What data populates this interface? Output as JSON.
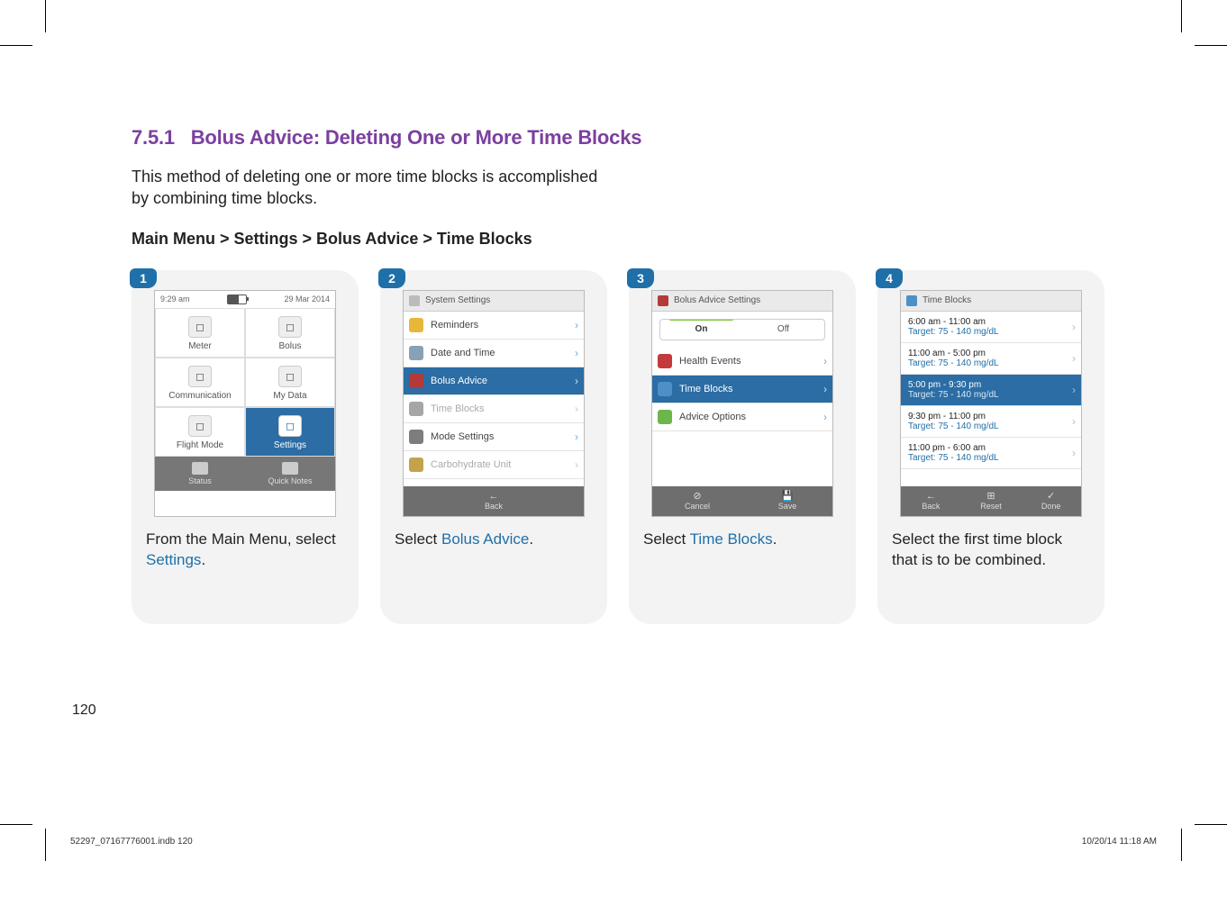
{
  "section": {
    "number": "7.5.1",
    "title": "Bolus Advice: Deleting One or More Time Blocks"
  },
  "intro": "This method of deleting one or more time blocks is accomplished by combining time blocks.",
  "navpath": "Main Menu > Settings > Bolus Advice > Time Blocks",
  "page_number": "120",
  "file_footer_left": "52297_07167776001.indb   120",
  "file_footer_right": "10/20/14   11:18 AM",
  "steps": {
    "1": {
      "badge": "1",
      "screen": {
        "time": "9:29 am",
        "date": "29 Mar 2014",
        "cells": [
          {
            "label": "Meter",
            "icon": "meter-icon"
          },
          {
            "label": "Bolus",
            "icon": "bolus-icon"
          },
          {
            "label": "Communication",
            "icon": "comm-icon"
          },
          {
            "label": "My Data",
            "icon": "mydata-icon"
          },
          {
            "label": "Flight Mode",
            "icon": "flight-icon"
          },
          {
            "label": "Settings",
            "icon": "settings-icon",
            "selected": true
          }
        ],
        "bottom": [
          {
            "label": "Status"
          },
          {
            "label": "Quick Notes"
          }
        ]
      },
      "caption_parts": [
        "From the Main Menu, select ",
        "Settings",
        "."
      ]
    },
    "2": {
      "badge": "2",
      "screen": {
        "title": "System Settings",
        "rows": [
          {
            "label": "Reminders",
            "icon": "#e7b73a"
          },
          {
            "label": "Date and Time",
            "icon": "#89a1b6"
          },
          {
            "label": "Bolus Advice",
            "icon": "#b43a3a",
            "selected": true
          },
          {
            "label": "Time Blocks",
            "icon": "#a6a6a6",
            "disabled": true
          },
          {
            "label": "Mode Settings",
            "icon": "#7d7d7d"
          },
          {
            "label": "Carbohydrate Unit",
            "icon": "#c4a24a",
            "disabled": true
          }
        ],
        "footer": [
          {
            "icon": "←",
            "label": "Back"
          }
        ]
      },
      "caption_parts": [
        "Select ",
        "Bolus Advice",
        "."
      ]
    },
    "3": {
      "badge": "3",
      "screen": {
        "title": "Bolus Advice Settings",
        "toggle": {
          "on": "On",
          "off": "Off"
        },
        "rows": [
          {
            "label": "Health Events",
            "icon": "#c43a3a"
          },
          {
            "label": "Time Blocks",
            "icon": "#4c90c7",
            "selected": true
          },
          {
            "label": "Advice Options",
            "icon": "#6db64b"
          }
        ],
        "footer": [
          {
            "icon": "⊘",
            "label": "Cancel"
          },
          {
            "icon": "💾",
            "label": "Save"
          }
        ]
      },
      "caption_parts": [
        "Select ",
        "Time Blocks",
        "."
      ]
    },
    "4": {
      "badge": "4",
      "screen": {
        "title": "Time Blocks",
        "blocks": [
          {
            "range": "6:00 am - 11:00 am",
            "target": "Target: 75 - 140 mg/dL"
          },
          {
            "range": "11:00 am - 5:00 pm",
            "target": "Target: 75 - 140 mg/dL"
          },
          {
            "range": "5:00 pm - 9:30 pm",
            "target": "Target: 75 - 140 mg/dL",
            "selected": true
          },
          {
            "range": "9:30 pm - 11:00 pm",
            "target": "Target: 75 - 140 mg/dL"
          },
          {
            "range": "11:00 pm - 6:00 am",
            "target": "Target: 75 - 140 mg/dL"
          }
        ],
        "footer": [
          {
            "icon": "←",
            "label": "Back"
          },
          {
            "icon": "⊞",
            "label": "Reset"
          },
          {
            "icon": "✓",
            "label": "Done"
          }
        ]
      },
      "caption": "Select the first time block that is to be combined."
    }
  }
}
